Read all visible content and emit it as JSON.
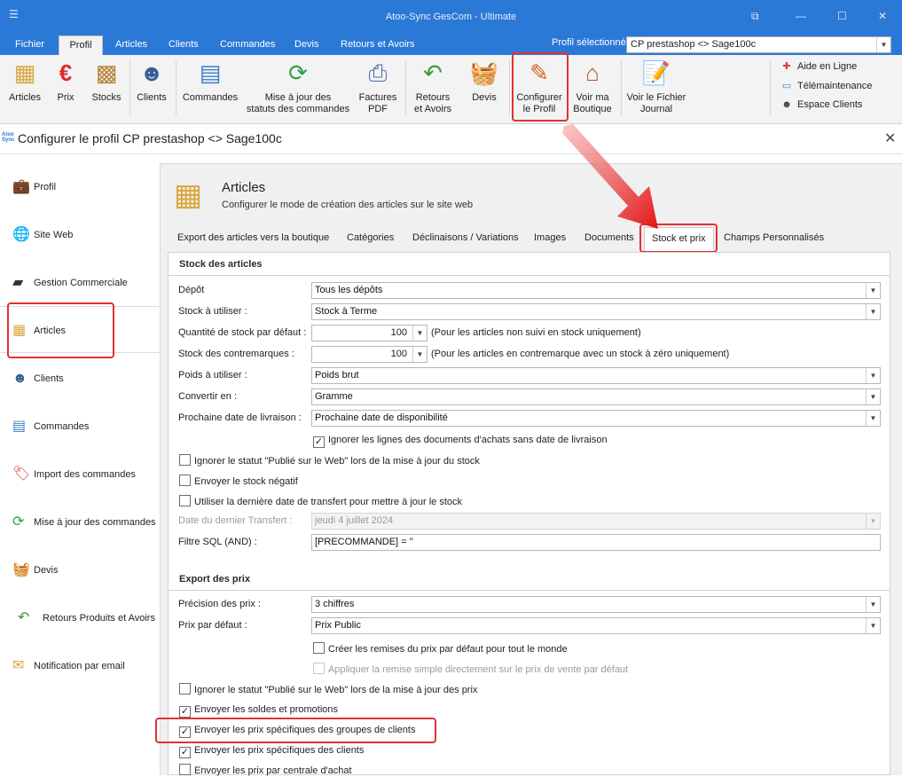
{
  "window": {
    "title": "Atoo-Sync GesCom - Ultimate"
  },
  "menu": {
    "tabs": [
      "Fichier",
      "Profil",
      "Articles",
      "Clients",
      "Commandes",
      "Devis",
      "Retours et Avoirs"
    ],
    "profile_label": "Profil sélectionné",
    "profile_value": "CP prestashop <> Sage100c"
  },
  "ribbon": {
    "buttons": [
      {
        "label": "Articles"
      },
      {
        "label": "Prix"
      },
      {
        "label": "Stocks"
      },
      {
        "label": "Clients"
      },
      {
        "label": "Commandes"
      },
      {
        "label1": "Mise à jour des",
        "label2": "statuts des commandes"
      },
      {
        "label1": "Factures",
        "label2": "PDF"
      },
      {
        "label1": "Retours",
        "label2": "et Avoirs"
      },
      {
        "label": "Devis"
      },
      {
        "label1": "Configurer",
        "label2": "le Profil"
      },
      {
        "label1": "Voir ma",
        "label2": "Boutique"
      },
      {
        "label1": "Voir le Fichier",
        "label2": "Journal"
      }
    ],
    "links": [
      "Aide en Ligne",
      "Télémaintenance",
      "Espace Clients"
    ]
  },
  "dialog": {
    "title": "Configurer le profil CP prestashop <> Sage100c",
    "logo": "Atoo Sync"
  },
  "nav": [
    "Profil",
    "Site Web",
    "Gestion Commerciale",
    "Articles",
    "Clients",
    "Commandes",
    "Import des commandes",
    "Mise à jour des commandes",
    "Devis",
    "Retours Produits et Avoirs",
    "Notification par email"
  ],
  "header": {
    "title": "Articles",
    "subtitle": "Configurer le mode de création des articles sur le site web"
  },
  "tabs": [
    "Export des articles vers la boutique",
    "Catégories",
    "Déclinaisons / Variations",
    "Images",
    "Documents",
    "Stock et prix",
    "Champs Personnalisés"
  ],
  "stock": {
    "section": "Stock des articles",
    "depot_label": "Dépôt",
    "depot_value": "Tous les dépôts",
    "stock_label": "Stock à utiliser :",
    "stock_value": "Stock à Terme",
    "qty_label": "Quantité de stock par défaut :",
    "qty_value": "100",
    "qty_note": "(Pour les articles non suivi en stock uniquement)",
    "contre_label": "Stock des contremarques :",
    "contre_value": "100",
    "contre_note": "(Pour les articles en contremarque avec un stock à zéro uniquement)",
    "poids_label": "Poids à utiliser :",
    "poids_value": "Poids brut",
    "conv_label": "Convertir en :",
    "conv_value": "Gramme",
    "livr_label": "Prochaine date de livraison :",
    "livr_value": "Prochaine date de disponibilité",
    "cb_ignore_lines": "Ignorer les lignes des documents d'achats sans date de livraison",
    "cb_ignore_status": "Ignorer le statut \"Publié sur le Web\" lors de la mise à jour du stock",
    "cb_negative": "Envoyer le stock négatif",
    "cb_last_date": "Utiliser la dernière date de transfert pour mettre à jour le stock",
    "last_label": "Date du dernier Transfert :",
    "last_value": "jeudi 4 juillet 2024",
    "sql_label": "Filtre SQL (AND) :",
    "sql_value": "[PRECOMMANDE] = ''"
  },
  "prices": {
    "section": "Export des prix",
    "prec_label": "Précision des prix :",
    "prec_value": "3 chiffres",
    "def_label": "Prix par défaut :",
    "def_value": "Prix Public",
    "cb_remises": "Créer les remises du prix par défaut pour tout le monde",
    "cb_remise_simple": "Appliquer la remise simple directement sur le prix de vente par défaut",
    "cb_ignore_status": "Ignorer le statut \"Publié sur le Web\"  lors de la mise à jour des prix",
    "cb_soldes": "Envoyer les soldes et promotions",
    "cb_groupes": "Envoyer les prix spécifiques des groupes de clients",
    "cb_clients": "Envoyer les prix spécifiques des clients",
    "cb_centrale": "Envoyer les prix par centrale d'achat"
  },
  "colors": {
    "accent": "#2b79d7",
    "highlight": "#e23131"
  }
}
